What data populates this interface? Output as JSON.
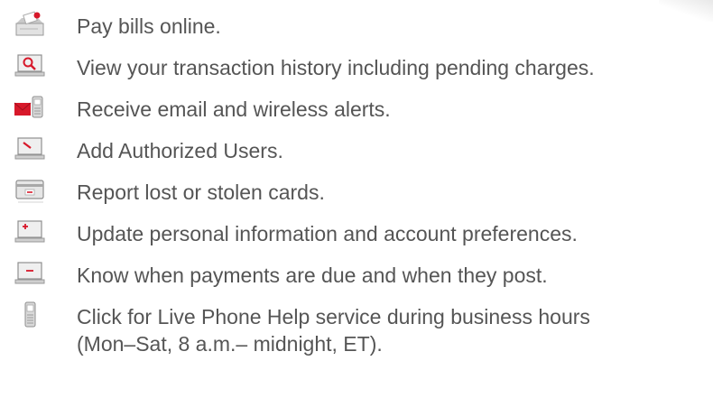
{
  "features": [
    {
      "icon": "bill-payment-icon",
      "text": "Pay bills online."
    },
    {
      "icon": "transaction-search-icon",
      "text": "View your transaction history including pending charges."
    },
    {
      "icon": "email-wireless-alerts-icon",
      "text": "Receive email and wireless alerts."
    },
    {
      "icon": "authorized-users-icon",
      "text": "Add Authorized Users."
    },
    {
      "icon": "lost-card-icon",
      "text": "Report lost or stolen cards."
    },
    {
      "icon": "update-info-icon",
      "text": "Update personal information and account preferences."
    },
    {
      "icon": "payment-due-icon",
      "text": "Know when payments are due and when they post."
    },
    {
      "icon": "phone-help-icon",
      "text": "Click for Live Phone Help service during business hours",
      "text_line2": "(Mon–Sat, 8 a.m.– midnight, ET)."
    }
  ],
  "colors": {
    "text": "#555555",
    "accent_red": "#d7182a",
    "icon_gray": "#9a9a9a"
  }
}
